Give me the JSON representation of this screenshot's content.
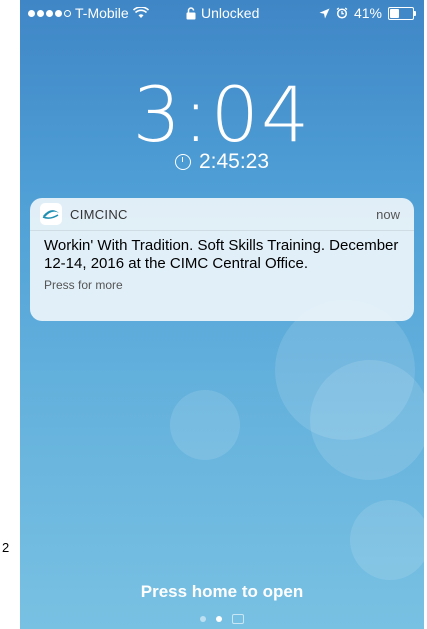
{
  "status_bar": {
    "carrier": "T-Mobile",
    "lock_label": "Unlocked",
    "battery": "41%",
    "battery_level": 0.41
  },
  "lock_screen": {
    "time": "3:04",
    "timer": "2:45:23",
    "press_home": "Press home to open"
  },
  "notification": {
    "app_name": "CIMCINC",
    "time": "now",
    "message": "Workin' With Tradition. Soft Skills Training. December 12-14, 2016 at the CIMC Central Office.",
    "action": "Press for more"
  },
  "edge_label": "2",
  "colors": {
    "wallpaper_top": "#3f86c6",
    "wallpaper_bottom": "#79c1e3",
    "app_icon_accent": "#1f8fb2"
  }
}
